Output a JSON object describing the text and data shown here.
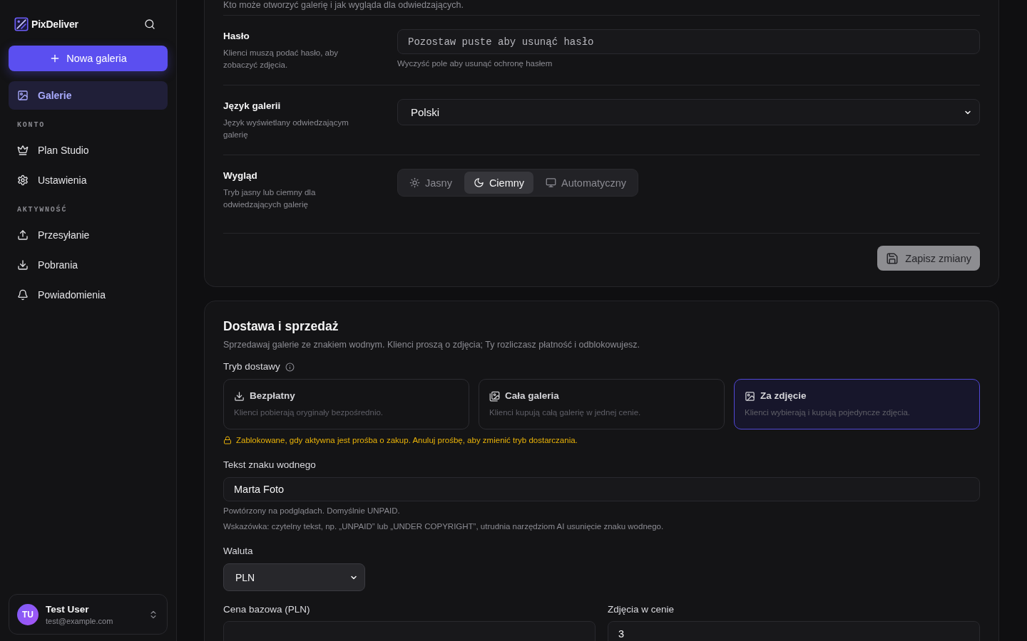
{
  "sidebar": {
    "app_name": "PixDeliver",
    "new_button": "Nowa galeria",
    "nav": [
      {
        "label": "Galerie",
        "selected": true
      }
    ],
    "sections": [
      {
        "heading": "KONTO",
        "items": [
          {
            "label": "Plan Studio",
            "selected": false
          },
          {
            "label": "Ustawienia",
            "selected": false
          }
        ]
      },
      {
        "heading": "AKTYWNOŚĆ",
        "items": [
          {
            "label": "Przesyłanie",
            "selected": false
          },
          {
            "label": "Pobrania",
            "selected": false
          },
          {
            "label": "Powiadomienia",
            "selected": false
          }
        ]
      }
    ],
    "user": {
      "initials": "TU",
      "name": "Test User",
      "email": "test@example.com"
    }
  },
  "gallery_settings": {
    "intro": "Kto może otworzyć galerię i jak wygląda dla odwiedzających.",
    "rows": [
      {
        "kind": "password",
        "title": "Hasło",
        "description": "Klienci muszą podać hasło, aby zobaczyć zdjęcia.",
        "placeholder": "Pozostaw puste aby usunąć hasło",
        "hint": "Wyczyść pole aby usunąć ochronę hasłem"
      },
      {
        "kind": "select",
        "title": "Język galerii",
        "description": "Język wyświetlany odwiedzającym galerię",
        "value": "Polski"
      },
      {
        "kind": "segmented",
        "title": "Wygląd",
        "description": "Tryb jasny lub ciemny dla odwiedzających galerię",
        "options": [
          {
            "label": "Jasny",
            "selected": false
          },
          {
            "label": "Ciemny",
            "selected": true
          },
          {
            "label": "Automatyczny",
            "selected": false
          }
        ]
      }
    ],
    "save_button": {
      "label": "Zapisz zmiany",
      "disabled": true
    }
  },
  "delivery": {
    "title": "Dostawa i sprzedaż",
    "description": "Sprzedawaj galerie ze znakiem wodnym. Klienci proszą o zdjęcia; Ty rozliczasz płatność i odblokowujesz.",
    "mode_label": "Tryb dostawy",
    "modes": [
      {
        "title": "Bezpłatny",
        "description": "Klienci pobierają oryginały bezpośrednio.",
        "selected": false
      },
      {
        "title": "Cała galeria",
        "description": "Klienci kupują całą galerię w jednej cenie.",
        "selected": false
      },
      {
        "title": "Za zdjęcie",
        "description": "Klienci wybierają i kupują pojedyncze zdjęcia.",
        "selected": true
      }
    ],
    "lock_notice": "Zablokowane, gdy aktywna jest prośba o zakup. Anuluj prośbę, aby zmienić tryb dostarczania.",
    "watermark": {
      "label": "Tekst znaku wodnego",
      "value": "Marta Foto",
      "hints": [
        "Powtórzony na podglądach. Domyślnie UNPAID.",
        "Wskazówka: czytelny tekst, np. „UNPAID” lub „UNDER COPYRIGHT”, utrudnia narzędziom AI usunięcie znaku wodnego."
      ]
    },
    "currency": {
      "label": "Waluta",
      "value": "PLN"
    },
    "pricing": [
      {
        "label": "Cena bazowa (PLN)"
      },
      {
        "label": "Zdjęcia w cenie",
        "value": "3"
      }
    ]
  }
}
